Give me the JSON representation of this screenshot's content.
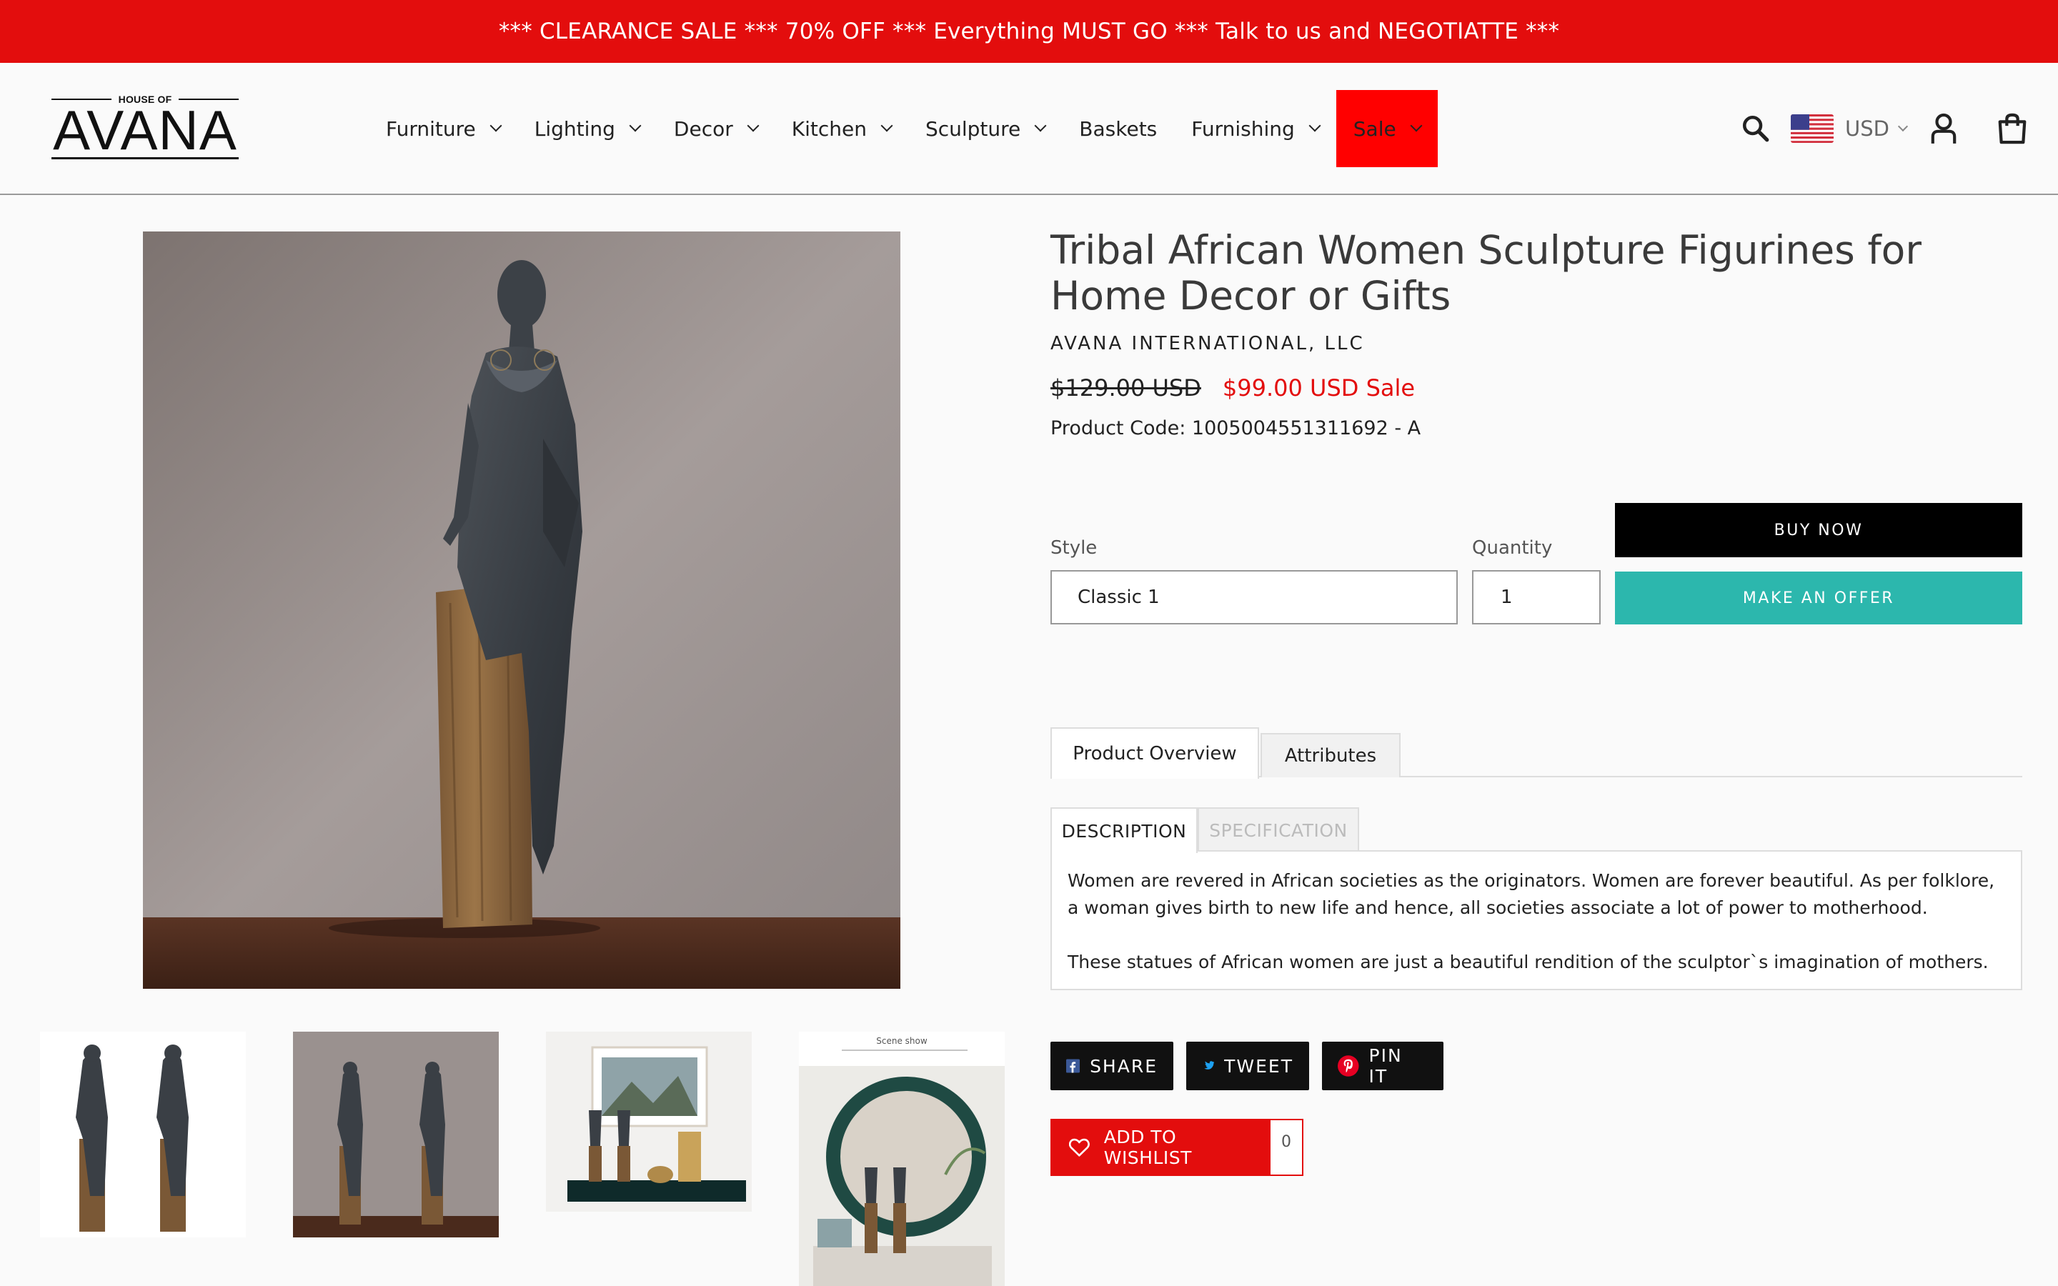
{
  "announcement": "*** CLEARANCE SALE *** 70% OFF *** Everything MUST GO *** Talk to us and NEGOTIATTE ***",
  "logo": {
    "top_text": "HOUSE OF",
    "name": "AVANA"
  },
  "nav": {
    "furniture": "Furniture",
    "lighting": "Lighting",
    "decor": "Decor",
    "kitchen": "Kitchen",
    "sculpture": "Sculpture",
    "baskets": "Baskets",
    "furnishing": "Furnishing",
    "sale": "Sale"
  },
  "header_right": {
    "currency": "USD",
    "icons": [
      "search-icon",
      "us-flag-icon",
      "account-icon",
      "cart-icon"
    ]
  },
  "product": {
    "title": "Tribal African Women Sculpture Figurines for Home Decor or Gifts",
    "vendor": "AVANA INTERNATIONAL, LLC",
    "price_regular": "$129.00 USD",
    "price_sale": "$99.00 USD Sale",
    "code": "Product Code: 1005004551311692 - A"
  },
  "form": {
    "style_label": "Style",
    "style_value": "Classic 1",
    "quantity_label": "Quantity",
    "quantity_value": "1",
    "buy_now": "BUY NOW",
    "make_offer": "MAKE AN OFFER"
  },
  "tabs": {
    "overview": "Product Overview",
    "attributes": "Attributes"
  },
  "subtabs": {
    "description": "DESCRIPTION",
    "specification": "SPECIFICATION"
  },
  "thumb_captions": {
    "thumb3": "",
    "thumb4": "Scene show"
  },
  "description": {
    "p1": "Women are revered in African societies as the originators. Women are forever beautiful. As per folklore, a woman gives birth to new life and hence, all societies associate a lot of power to motherhood.",
    "p2": "These statues of African women are just a beautiful rendition of the sculptor`s imagination of mothers."
  },
  "share": {
    "facebook": "SHARE",
    "twitter": "TWEET",
    "pinterest": "PIN IT"
  },
  "wishlist": {
    "label": "ADD TO WISHLIST",
    "count": "0"
  },
  "colors": {
    "announce_red": "#e30d0d",
    "sale_red": "#ff0000",
    "offer_teal": "#2cb7ad"
  }
}
